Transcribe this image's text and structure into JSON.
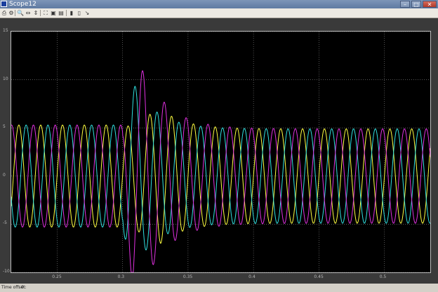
{
  "window": {
    "title": "Scope12",
    "minimize": "–",
    "maximize": "□",
    "close": "✕"
  },
  "toolbar": {
    "buttons": [
      {
        "icon": "print-icon",
        "glyph": "⎙"
      },
      {
        "icon": "params-icon",
        "glyph": "⚙"
      },
      {
        "icon": "zoom-icon",
        "glyph": "🔍"
      },
      {
        "icon": "zoom-x-icon",
        "glyph": "⇔"
      },
      {
        "icon": "zoom-y-icon",
        "glyph": "⇕"
      },
      {
        "icon": "autoscale-icon",
        "glyph": "⛶"
      },
      {
        "icon": "save-axes-icon",
        "glyph": "▣"
      },
      {
        "icon": "restore-axes-icon",
        "glyph": "▤"
      },
      {
        "icon": "float-scope-icon",
        "glyph": "▮"
      },
      {
        "icon": "lock-axes-icon",
        "glyph": "▯"
      },
      {
        "icon": "signal-selection-icon",
        "glyph": "↘"
      }
    ]
  },
  "status": {
    "label": "Time offset:",
    "value": "0"
  },
  "chart_data": {
    "type": "line",
    "title": "",
    "xlabel": "",
    "ylabel": "",
    "xlim": [
      0.215,
      0.535
    ],
    "ylim": [
      -10,
      15
    ],
    "xticks": [
      "0.25",
      "0.3",
      "0.35",
      "0.4",
      "0.45",
      "0.5"
    ],
    "xtick_values": [
      0.25,
      0.3,
      0.35,
      0.4,
      0.45,
      0.5
    ],
    "yticks": [
      "-10",
      "-5",
      "0",
      "5",
      "10",
      "15"
    ],
    "ytick_values": [
      -10,
      -5,
      0,
      5,
      10,
      15
    ],
    "grid": true,
    "background": "#000000",
    "frequency_hz": 60,
    "fault_time": 0.3,
    "series": [
      {
        "color": "#ffff40",
        "phase_deg": 0,
        "steady_amplitude": 5.3,
        "post_fault_amplitude": 4.9,
        "transient_peak": 7.0,
        "transient_peak_time": 0.329
      },
      {
        "color": "#30e0e0",
        "phase_deg": 120,
        "steady_amplitude": 5.3,
        "post_fault_amplitude": 4.9,
        "transient_peak": 10.3,
        "transient_peak_time": 0.306
      },
      {
        "color": "#e030e0",
        "phase_deg": 240,
        "steady_amplitude": 5.3,
        "post_fault_amplitude": 4.9,
        "transient_peak": -9.7,
        "transient_peak_time": 0.308,
        "second_peak": 11.2,
        "second_peak_time": 0.317
      }
    ]
  }
}
